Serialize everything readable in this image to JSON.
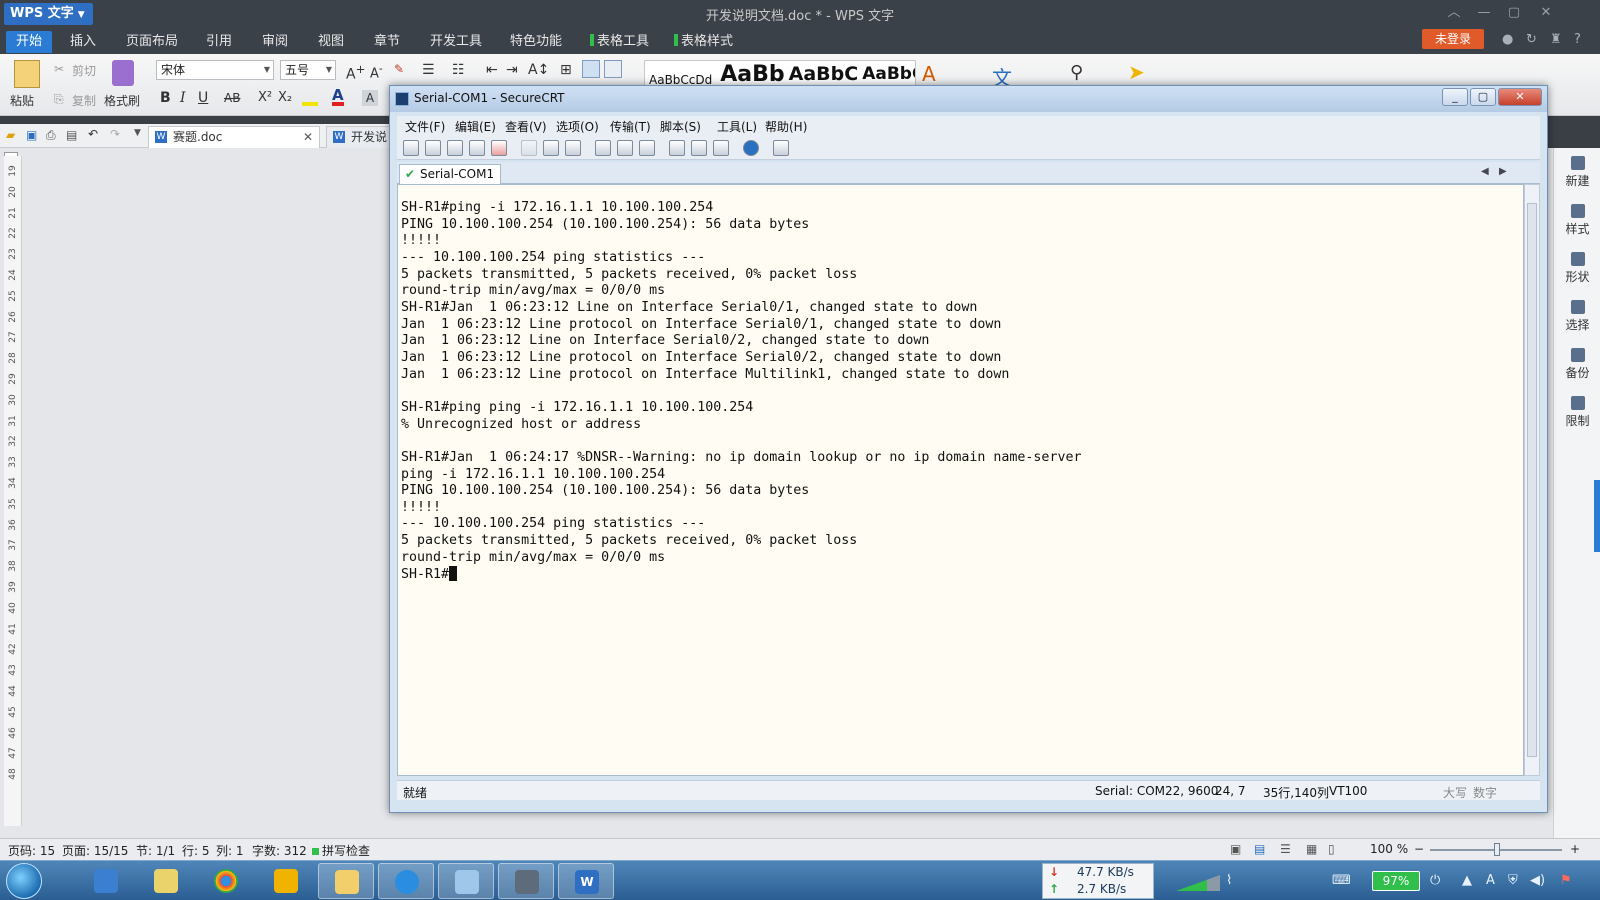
{
  "wps": {
    "app_name": "WPS 文字",
    "doc_title": "开发说明文档.doc * - WPS 文字",
    "tabs": [
      "开始",
      "插入",
      "页面布局",
      "引用",
      "审阅",
      "视图",
      "章节",
      "开发工具",
      "特色功能",
      "表格工具",
      "表格样式"
    ],
    "login_label": "未登录",
    "ribbon": {
      "paste": "粘贴",
      "cut": "剪切",
      "copy": "复制",
      "format_painter": "格式刷",
      "font_name": "宋体",
      "font_size": "五号",
      "styles": [
        "AaBbCcDd",
        "AaBb",
        "AaBbC",
        "AaBbC"
      ]
    },
    "doc_tabs": [
      "赛题.doc",
      "开发说"
    ],
    "ruler_numbers": [
      "19",
      "20",
      "21",
      "22",
      "23",
      "24",
      "25",
      "26",
      "27",
      "28",
      "29",
      "30",
      "31",
      "32",
      "33",
      "34",
      "35",
      "36",
      "37",
      "38",
      "39",
      "40",
      "41",
      "42",
      "43",
      "44",
      "45",
      "46",
      "47",
      "48"
    ],
    "right_panel": [
      "新建",
      "样式",
      "形状",
      "选择",
      "备份",
      "限制"
    ],
    "status": {
      "page_code": "页码: 15",
      "page": "页面: 15/15",
      "section": "节: 1/1",
      "row": "行: 5",
      "col": "列: 1",
      "word_count": "字数: 312",
      "spell_check": "拼写检查",
      "zoom": "100 %"
    }
  },
  "securecrt": {
    "title": "Serial-COM1 - SecureCRT",
    "menu": [
      "文件(F)",
      "编辑(E)",
      "查看(V)",
      "选项(O)",
      "传输(T)",
      "脚本(S)",
      "工具(L)",
      "帮助(H)"
    ],
    "session_tab": "Serial-COM1",
    "terminal_lines": [
      "SH-R1#ping -i 172.16.1.1 10.100.100.254",
      "PING 10.100.100.254 (10.100.100.254): 56 data bytes",
      "!!!!!",
      "--- 10.100.100.254 ping statistics ---",
      "5 packets transmitted, 5 packets received, 0% packet loss",
      "round-trip min/avg/max = 0/0/0 ms",
      "SH-R1#Jan  1 06:23:12 Line on Interface Serial0/1, changed state to down",
      "Jan  1 06:23:12 Line protocol on Interface Serial0/1, changed state to down",
      "Jan  1 06:23:12 Line on Interface Serial0/2, changed state to down",
      "Jan  1 06:23:12 Line protocol on Interface Serial0/2, changed state to down",
      "Jan  1 06:23:12 Line protocol on Interface Multilink1, changed state to down",
      "",
      "SH-R1#ping ping -i 172.16.1.1 10.100.100.254",
      "% Unrecognized host or address",
      "",
      "SH-R1#Jan  1 06:24:17 %DNSR--Warning: no ip domain lookup or no ip domain name-server",
      "ping -i 172.16.1.1 10.100.100.254",
      "PING 10.100.100.254 (10.100.100.254): 56 data bytes",
      "!!!!!",
      "--- 10.100.100.254 ping statistics ---",
      "5 packets transmitted, 5 packets received, 0% packet loss",
      "round-trip min/avg/max = 0/0/0 ms"
    ],
    "prompt": "SH-R1#",
    "status": {
      "ready": "就绪",
      "serial": "Serial: COM22, 9600",
      "cursor_pos": "24,  7",
      "size": "35行,140列",
      "emulation": "VT100",
      "caps": "大写",
      "num": "数字"
    }
  },
  "taskbar": {
    "net_down": "47.7 KB/s",
    "net_up": "2.7 KB/s",
    "battery": "97%"
  }
}
